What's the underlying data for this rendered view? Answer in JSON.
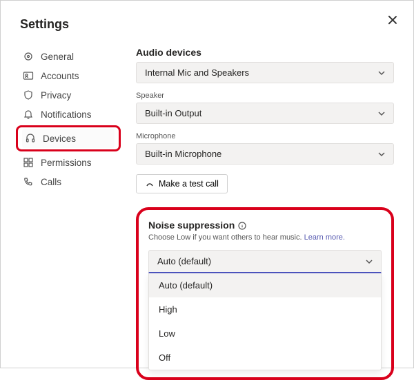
{
  "window": {
    "title": "Settings"
  },
  "sidebar": {
    "items": [
      {
        "label": "General"
      },
      {
        "label": "Accounts"
      },
      {
        "label": "Privacy"
      },
      {
        "label": "Notifications"
      },
      {
        "label": "Devices"
      },
      {
        "label": "Permissions"
      },
      {
        "label": "Calls"
      }
    ]
  },
  "audio": {
    "section_label": "Audio devices",
    "device_value": "Internal Mic and Speakers",
    "speaker_label": "Speaker",
    "speaker_value": "Built-in Output",
    "mic_label": "Microphone",
    "mic_value": "Built-in Microphone",
    "test_call_label": "Make a test call"
  },
  "noise": {
    "title": "Noise suppression",
    "description": "Choose Low if you want others to hear music.",
    "learn_more": "Learn more.",
    "selected": "Auto (default)",
    "options": [
      "Auto (default)",
      "High",
      "Low",
      "Off"
    ]
  },
  "colors": {
    "highlight": "#d9001b",
    "accent": "#4b53bc"
  }
}
